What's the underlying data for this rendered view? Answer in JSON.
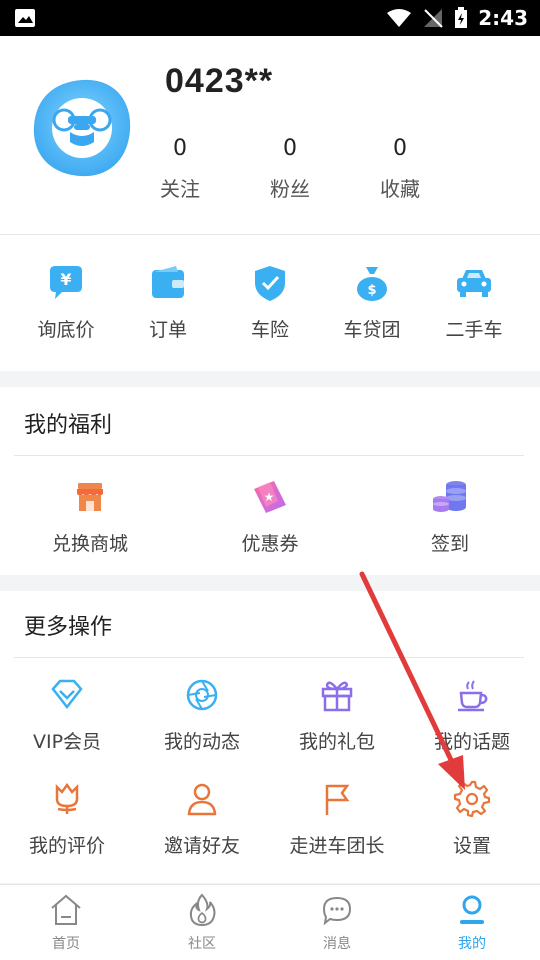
{
  "status_bar": {
    "time": "2:43"
  },
  "profile": {
    "username": "0423**",
    "stats": [
      {
        "value": "0",
        "label": "关注"
      },
      {
        "value": "0",
        "label": "粉丝"
      },
      {
        "value": "0",
        "label": "收藏"
      }
    ]
  },
  "quick_actions": [
    {
      "label": "询底价",
      "icon": "yen-chat-icon"
    },
    {
      "label": "订单",
      "icon": "wallet-icon"
    },
    {
      "label": "车险",
      "icon": "shield-icon"
    },
    {
      "label": "车贷团",
      "icon": "money-bag-icon"
    },
    {
      "label": "二手车",
      "icon": "car-icon"
    }
  ],
  "benefits": {
    "title": "我的福利",
    "items": [
      {
        "label": "兑换商城",
        "icon": "store-icon"
      },
      {
        "label": "优惠券",
        "icon": "coupon-icon"
      },
      {
        "label": "签到",
        "icon": "coins-icon"
      }
    ]
  },
  "more": {
    "title": "更多操作",
    "items": [
      {
        "label": "VIP会员",
        "icon": "diamond-icon"
      },
      {
        "label": "我的动态",
        "icon": "aperture-icon"
      },
      {
        "label": "我的礼包",
        "icon": "gift-icon"
      },
      {
        "label": "我的话题",
        "icon": "coffee-icon"
      },
      {
        "label": "我的评价",
        "icon": "flower-icon"
      },
      {
        "label": "邀请好友",
        "icon": "person-icon"
      },
      {
        "label": "走进车团长",
        "icon": "flag-icon"
      },
      {
        "label": "设置",
        "icon": "gear-icon"
      }
    ]
  },
  "tabbar": {
    "tabs": [
      {
        "label": "首页",
        "icon": "home-icon",
        "active": false
      },
      {
        "label": "社区",
        "icon": "flame-icon",
        "active": false
      },
      {
        "label": "消息",
        "icon": "chat-icon",
        "active": false
      },
      {
        "label": "我的",
        "icon": "profile-icon",
        "active": true
      }
    ]
  },
  "colors": {
    "accent": "#2ea6ee",
    "more_icons": "#e8763a",
    "arrow": "#e23b3b"
  }
}
